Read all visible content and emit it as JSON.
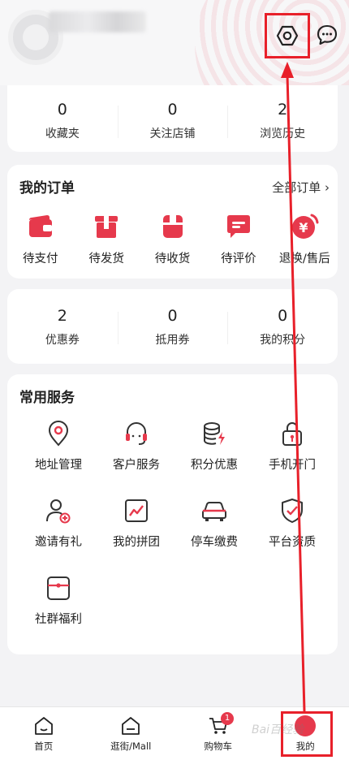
{
  "header": {},
  "stats": [
    {
      "value": "0",
      "label": "收藏夹"
    },
    {
      "value": "0",
      "label": "关注店铺"
    },
    {
      "value": "2",
      "label": "浏览历史"
    }
  ],
  "orders": {
    "title": "我的订单",
    "all_label": "全部订单 ›",
    "items": [
      {
        "label": "待支付",
        "icon": "wallet-icon"
      },
      {
        "label": "待发货",
        "icon": "box-icon"
      },
      {
        "label": "待收货",
        "icon": "package-icon"
      },
      {
        "label": "待评价",
        "icon": "comment-icon"
      },
      {
        "label": "退换/售后",
        "icon": "refund-icon"
      }
    ]
  },
  "assets": [
    {
      "value": "2",
      "label": "优惠券"
    },
    {
      "value": "0",
      "label": "抵用券"
    },
    {
      "value": "0",
      "label": "我的积分"
    }
  ],
  "services": {
    "title": "常用服务",
    "items": [
      {
        "label": "地址管理",
        "icon": "location-icon"
      },
      {
        "label": "客户服务",
        "icon": "headset-icon"
      },
      {
        "label": "积分优惠",
        "icon": "coins-icon"
      },
      {
        "label": "手机开门",
        "icon": "lock-icon"
      },
      {
        "label": "邀请有礼",
        "icon": "invite-user-icon"
      },
      {
        "label": "我的拼团",
        "icon": "chart-icon"
      },
      {
        "label": "停车缴费",
        "icon": "car-icon"
      },
      {
        "label": "平台资质",
        "icon": "shield-check-icon"
      },
      {
        "label": "社群福利",
        "icon": "gift-box-icon"
      }
    ]
  },
  "tabbar": {
    "items": [
      {
        "label": "首页",
        "icon": "home-icon"
      },
      {
        "label": "逛街/Mall",
        "icon": "mall-icon"
      },
      {
        "label": "购物车",
        "icon": "cart-icon",
        "badge": "1"
      },
      {
        "label": "我的",
        "icon": "profile-icon"
      }
    ]
  },
  "colors": {
    "accent": "#e6394c",
    "annotation": "#e8202a"
  },
  "watermark": "Bai百经验"
}
